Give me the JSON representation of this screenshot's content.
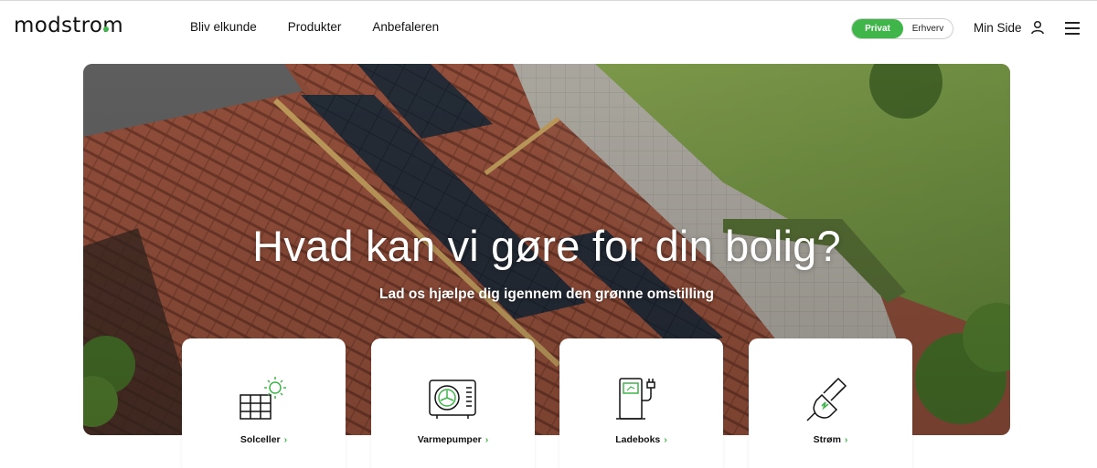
{
  "brand": {
    "logo_text": "modstrom",
    "accent": "#3fb54a"
  },
  "nav": {
    "items": [
      {
        "label": "Bliv elkunde"
      },
      {
        "label": "Produkter"
      },
      {
        "label": "Anbefaleren"
      }
    ]
  },
  "segment": {
    "active": "Privat",
    "inactive": "Erhverv"
  },
  "account": {
    "label": "Min Side",
    "icon": "user-icon"
  },
  "menu_icon": "hamburger-icon",
  "hero": {
    "title": "Hvad kan vi gøre for din bolig?",
    "subtitle": "Lad os hjælpe dig igennem den grønne omstilling"
  },
  "cards": [
    {
      "label": "Solceller",
      "icon": "solar-panel-icon",
      "chevron": "›"
    },
    {
      "label": "Varmepumper",
      "icon": "heat-pump-icon",
      "chevron": "›"
    },
    {
      "label": "Ladeboks",
      "icon": "charger-icon",
      "chevron": "›"
    },
    {
      "label": "Strøm",
      "icon": "plug-icon",
      "chevron": "›"
    }
  ]
}
